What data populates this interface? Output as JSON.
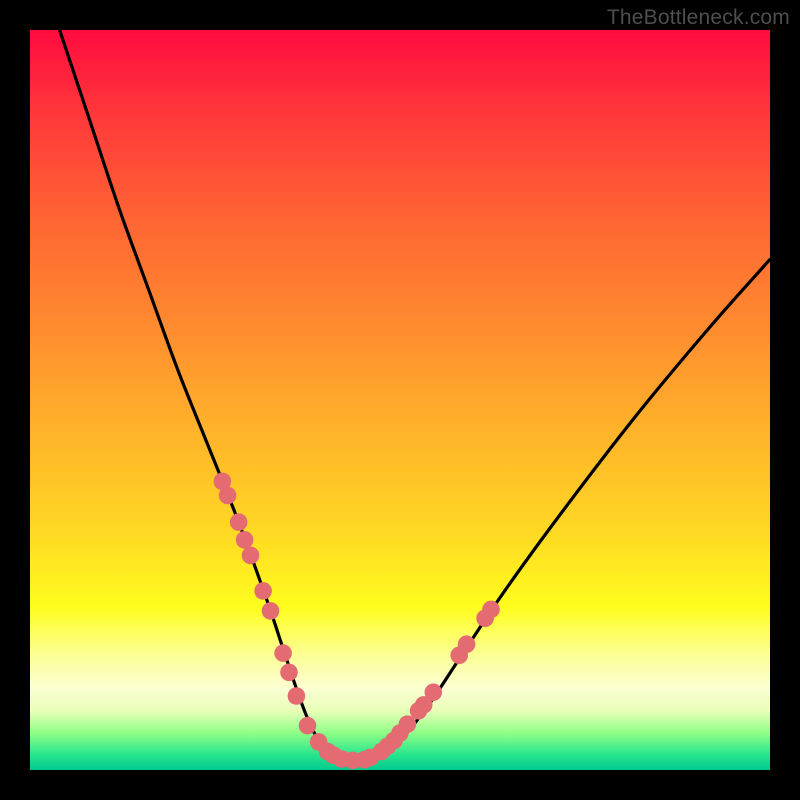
{
  "watermark": "TheBottleneck.com",
  "chart_data": {
    "type": "line",
    "title": "",
    "xlabel": "",
    "ylabel": "",
    "xlim": [
      0,
      100
    ],
    "ylim": [
      0,
      100
    ],
    "series": [
      {
        "name": "curve",
        "x": [
          4,
          8,
          12,
          16,
          20,
          24,
          28,
          32,
          34,
          36,
          37.5,
          39,
          41,
          43,
          45,
          47,
          50,
          54,
          58,
          64,
          72,
          82,
          92,
          100
        ],
        "y": [
          100,
          88,
          76,
          65,
          54,
          44,
          34,
          23,
          17,
          11,
          7,
          4,
          2,
          1,
          1,
          2,
          4,
          9,
          15,
          24,
          35,
          48,
          60,
          69
        ]
      }
    ],
    "markers": [
      {
        "x": 26.0,
        "y": 39.0
      },
      {
        "x": 26.7,
        "y": 37.1
      },
      {
        "x": 28.2,
        "y": 33.5
      },
      {
        "x": 29.0,
        "y": 31.1
      },
      {
        "x": 29.8,
        "y": 29.0
      },
      {
        "x": 31.5,
        "y": 24.2
      },
      {
        "x": 32.5,
        "y": 21.5
      },
      {
        "x": 34.2,
        "y": 15.8
      },
      {
        "x": 35.0,
        "y": 13.2
      },
      {
        "x": 36.0,
        "y": 10.0
      },
      {
        "x": 37.5,
        "y": 6.0
      },
      {
        "x": 39.0,
        "y": 3.8
      },
      {
        "x": 40.2,
        "y": 2.5
      },
      {
        "x": 41.0,
        "y": 2.0
      },
      {
        "x": 42.1,
        "y": 1.5
      },
      {
        "x": 43.6,
        "y": 1.3
      },
      {
        "x": 45.2,
        "y": 1.4
      },
      {
        "x": 46.0,
        "y": 1.7
      },
      {
        "x": 47.5,
        "y": 2.5
      },
      {
        "x": 48.3,
        "y": 3.2
      },
      {
        "x": 49.2,
        "y": 4.0
      },
      {
        "x": 50.0,
        "y": 5.0
      },
      {
        "x": 51.0,
        "y": 6.2
      },
      {
        "x": 52.5,
        "y": 8.0
      },
      {
        "x": 53.2,
        "y": 8.8
      },
      {
        "x": 54.5,
        "y": 10.5
      },
      {
        "x": 58.0,
        "y": 15.5
      },
      {
        "x": 59.0,
        "y": 17.0
      },
      {
        "x": 61.5,
        "y": 20.5
      },
      {
        "x": 62.3,
        "y": 21.7
      }
    ],
    "colors": {
      "curve": "#000000",
      "markers": "#e56b73",
      "gradient_top": "#ff0b3e",
      "gradient_bottom": "#00c98e"
    }
  }
}
